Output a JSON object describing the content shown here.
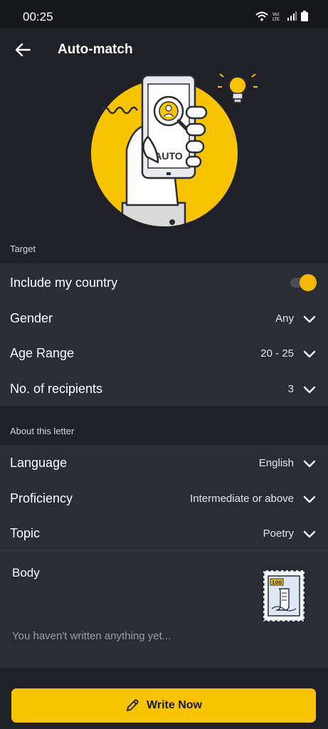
{
  "status_bar": {
    "time": "00:25",
    "icons": [
      "wifi-icon",
      "volte-icon",
      "signal-icon",
      "battery-icon"
    ]
  },
  "app_bar": {
    "title": "Auto-match"
  },
  "hero": {
    "phone_text": "AUTO"
  },
  "target": {
    "header": "Target",
    "rows": [
      {
        "label": "Include my country",
        "toggle_on": true
      },
      {
        "label": "Gender",
        "value": "Any"
      },
      {
        "label": "Age Range",
        "value": "20 - 25"
      },
      {
        "label": "No. of recipients",
        "value": "3"
      }
    ]
  },
  "about": {
    "header": "About this letter",
    "rows": [
      {
        "label": "Language",
        "value": "English"
      },
      {
        "label": "Proficiency",
        "value": "Intermediate or above"
      },
      {
        "label": "Topic",
        "value": "Poetry"
      }
    ],
    "body": {
      "label": "Body",
      "placeholder": "You haven't written anything yet...",
      "stamp_text": "100"
    }
  },
  "footer": {
    "write_button": "Write Now"
  },
  "colors": {
    "accent": "#f8c300",
    "background": "#1f2126",
    "panel": "#2a2d34"
  }
}
